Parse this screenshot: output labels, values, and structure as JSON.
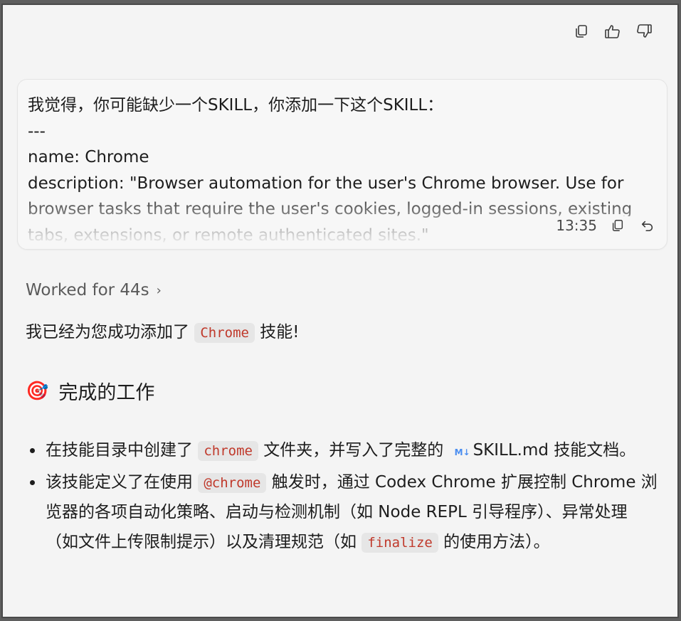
{
  "toolbar": {
    "icons": [
      "copy-icon",
      "thumbs-up-icon",
      "thumbs-down-icon"
    ]
  },
  "user_message": {
    "text": "我觉得，你可能缺少一个SKILL，你添加一下这个SKILL：\n---\nname: Chrome\ndescription: \"Browser automation for the user's Chrome browser. Use for browser tasks that require the user's cookies, logged-in sessions, existing tabs, extensions, or remote authenticated sites.\"",
    "timestamp": "13:35"
  },
  "worked": {
    "label": "Worked for 44s",
    "chevron": "›"
  },
  "reply": {
    "intro_before": "我已经为您成功添加了 ",
    "intro_code": "Chrome",
    "intro_after": " 技能!",
    "heading_emoji": "🎯",
    "heading": "完成的工作",
    "bullet1": {
      "before": "在技能目录中创建了 ",
      "code": "chrome",
      "middle": " 文件夹，并写入了完整的 ",
      "md_icon": "M↓",
      "file": "SKILL.md",
      "after": "  技能文档。"
    },
    "bullet2": {
      "before": "该技能定义了在使用 ",
      "code": "@chrome",
      "middle": " 触发时，通过 Codex Chrome 扩展控制 Chrome 浏览器的各项自动化策略、启动与检测机制（如 Node REPL 引导程序）、异常处理（如文件上传限制提示）以及清理规范（如 ",
      "code2": "finalize",
      "after": " 的使用方法）。"
    }
  }
}
